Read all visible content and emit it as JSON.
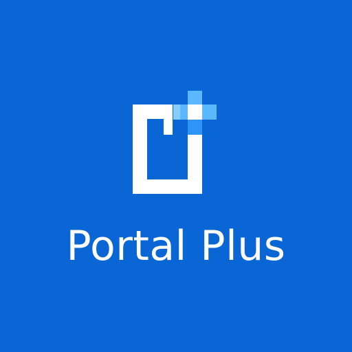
{
  "brand": {
    "name": "Portal Plus",
    "logo_icon": "portal-plus-logo-icon"
  },
  "colors": {
    "background": "#0a66d4",
    "mark": "#ffffff",
    "plus_light": "#5bb8ff",
    "plus_mid": "#2f95f5",
    "plus_pale": "#a9dcff"
  }
}
